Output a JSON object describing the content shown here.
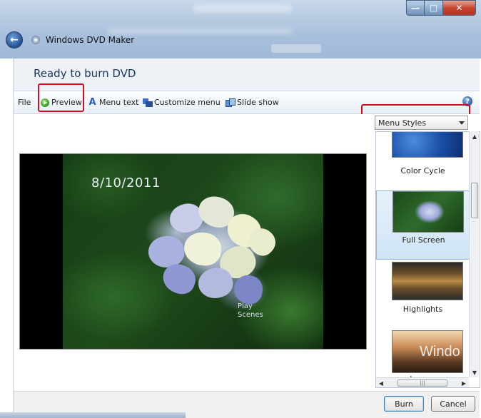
{
  "window": {
    "app_title": "Windows DVD Maker",
    "minimize_glyph": "—",
    "maximize_glyph": "□",
    "close_glyph": "✕"
  },
  "header": {
    "heading": "Ready to burn DVD"
  },
  "toolbar": {
    "file_label": "File",
    "preview_label": "Preview",
    "menu_text_label": "Menu text",
    "customize_menu_label": "Customize menu",
    "slide_show_label": "Slide show",
    "help_glyph": "?"
  },
  "preview": {
    "date_text": "8/10/2011",
    "play_label": "Play",
    "scenes_label": "Scenes"
  },
  "menu_styles": {
    "selected": "Menu Styles",
    "items": [
      {
        "label": "Color Cycle",
        "selected": false
      },
      {
        "label": "Full Screen",
        "selected": true
      },
      {
        "label": "Highlights",
        "selected": false
      },
      {
        "label": "Layers",
        "selected": false
      }
    ],
    "layers_thumb_text": "Windo"
  },
  "footer": {
    "burn_label": "Burn",
    "cancel_label": "Cancel"
  },
  "icons": {
    "back": "back-arrow-icon",
    "app": "dvd-maker-icon",
    "preview": "play-icon",
    "menu_text": "text-icon",
    "customize": "customize-icon",
    "slide_show": "slideshow-icon",
    "help": "help-icon"
  },
  "colors": {
    "highlight_red": "#d0101e",
    "heading_blue": "#1a3763",
    "selection_blue": "#cfe4f7"
  }
}
